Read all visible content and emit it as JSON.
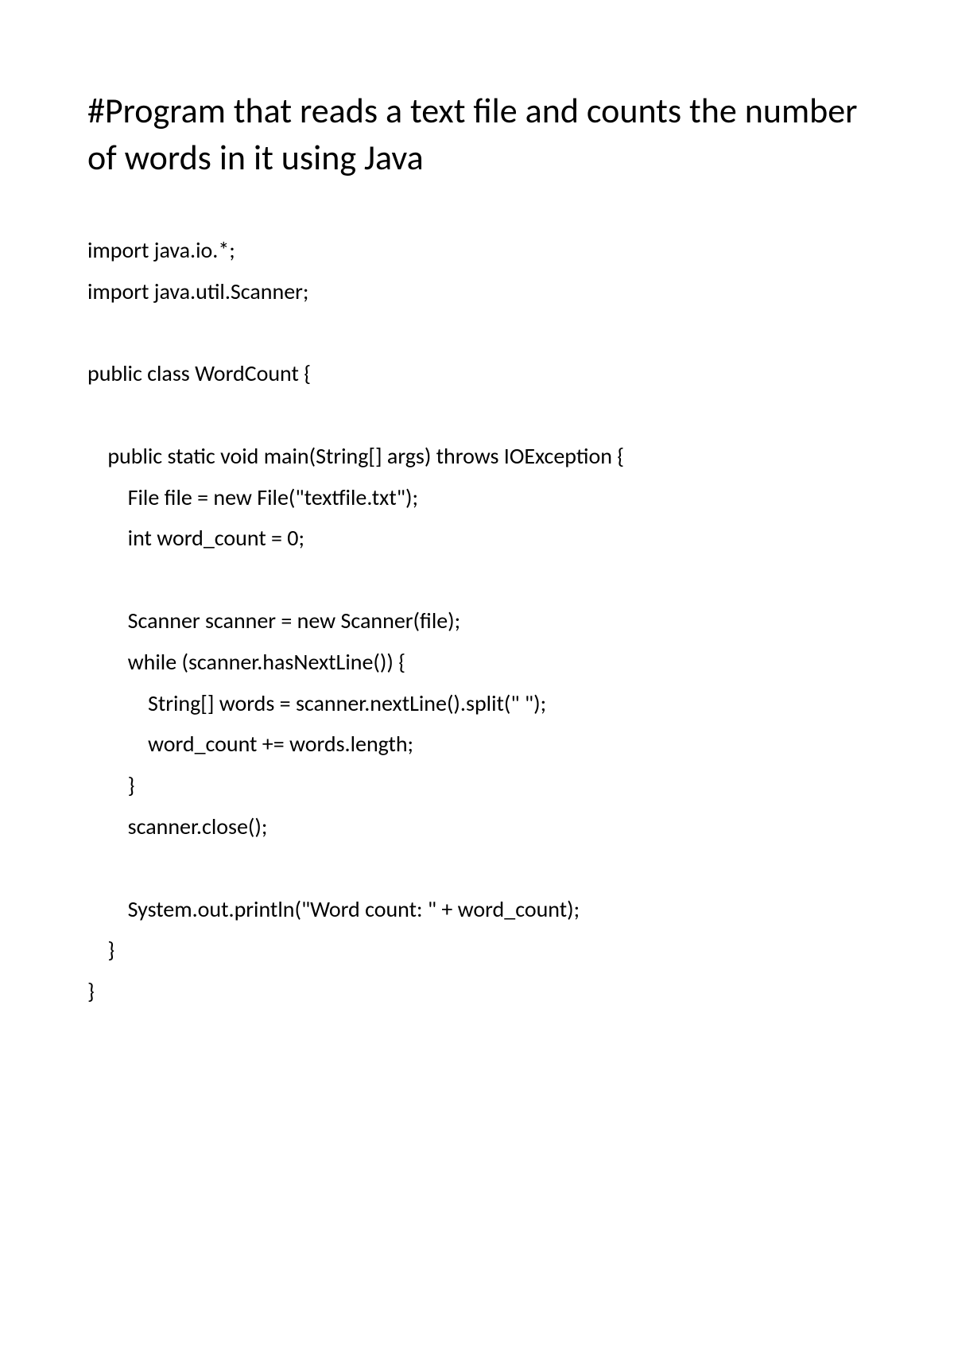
{
  "title": "#Program that reads a text file and counts the number of words in it using Java",
  "code": {
    "lines": [
      "import java.io.*;",
      "import java.util.Scanner;",
      "",
      "public class WordCount {",
      "",
      "    public static void main(String[] args) throws IOException {",
      "        File file = new File(\"textfile.txt\");",
      "        int word_count = 0;",
      "",
      "        Scanner scanner = new Scanner(file);",
      "        while (scanner.hasNextLine()) {",
      "            String[] words = scanner.nextLine().split(\" \");",
      "            word_count += words.length;",
      "        }",
      "        scanner.close();",
      "",
      "        System.out.println(\"Word count: \" + word_count);",
      "    }",
      "}"
    ]
  }
}
